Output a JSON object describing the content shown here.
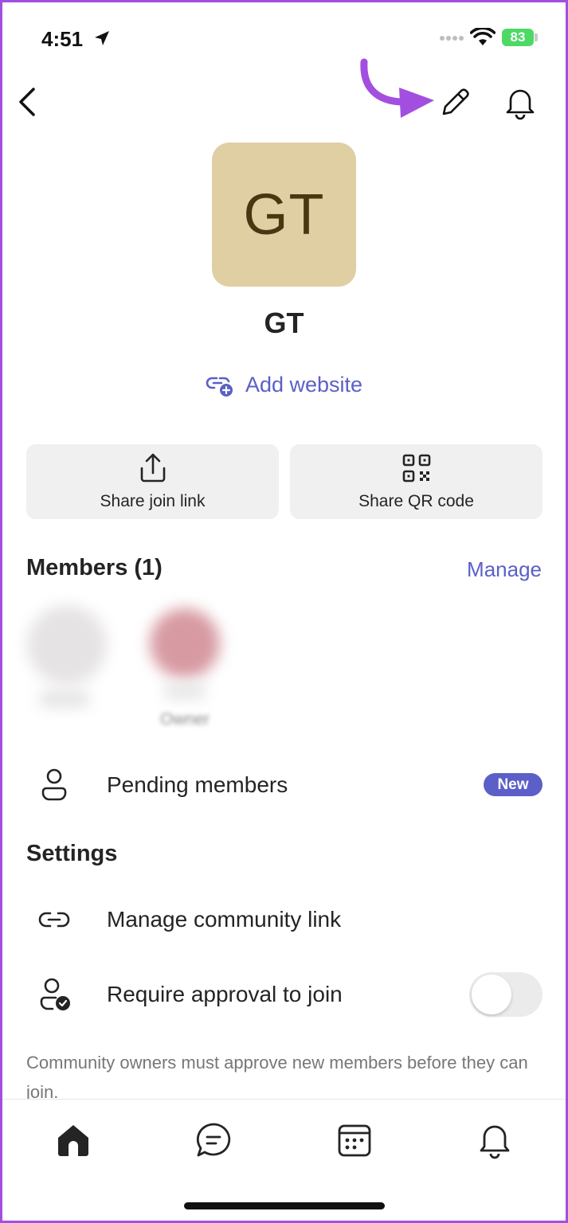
{
  "status_bar": {
    "time": "4:51",
    "battery": "83"
  },
  "profile": {
    "initials": "GT",
    "name": "GT",
    "avatar_color": "#e0cfa3",
    "initials_color": "#4a3712"
  },
  "add_website_label": "Add website",
  "share": {
    "join_link_label": "Share join link",
    "qr_code_label": "Share QR code"
  },
  "members": {
    "title": "Members (1)",
    "manage_label": "Manage",
    "owner_label": "Owner"
  },
  "pending": {
    "label": "Pending members",
    "badge": "New"
  },
  "settings": {
    "title": "Settings",
    "manage_link_label": "Manage community link",
    "require_approval_label": "Require approval to join",
    "require_approval_on": false,
    "hint": "Community owners must approve new members before they can join."
  },
  "colors": {
    "accent": "#5b5fc7",
    "annotation": "#a24fe0"
  },
  "tab_bar": {
    "icons": [
      "home-icon",
      "chat-icon",
      "calendar-icon",
      "bell-icon"
    ]
  }
}
